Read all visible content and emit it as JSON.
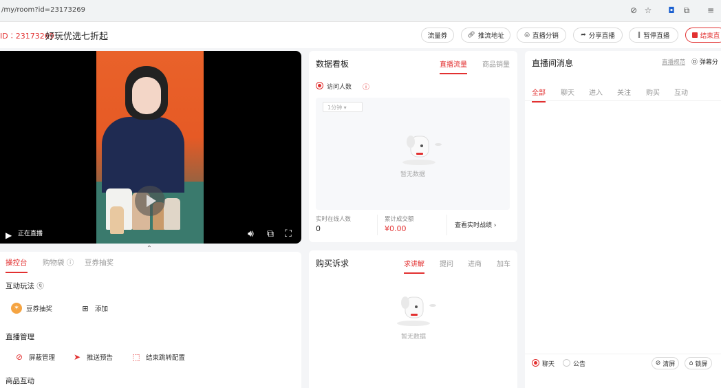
{
  "browser": {
    "url": "/my/room?id=23173269"
  },
  "header": {
    "room_id": "ID︰23173269",
    "title": "好玩优选七折起",
    "buttons": {
      "traffic": "流量券",
      "stream_url": "推流地址",
      "distribution": "直播分销",
      "share": "分享直播",
      "pause": "暂停直播",
      "end": "结束直"
    }
  },
  "video": {
    "status": "正在直播"
  },
  "console": {
    "tabs": [
      "操控台",
      "购物袋",
      "豆券抽奖"
    ],
    "interactive_title": "互动玩法",
    "lottery": "豆券抽奖",
    "add": "添加",
    "live_mgmt_title": "直播管理",
    "tools": [
      "屏蔽管理",
      "推送预告",
      "结束跳转配置"
    ],
    "product_interact_title": "商品互动"
  },
  "dashboard": {
    "title": "数据看板",
    "tabs": [
      "直播流量",
      "商品销量"
    ],
    "metric_radio": "访问人数",
    "interval": "1分钟",
    "empty": "暂无数据",
    "online_label": "实时在线人数",
    "online_value": "0",
    "gmv_label": "累计成交额",
    "gmv_value": "¥0.00",
    "view_realtime": "查看实时战绩"
  },
  "purchase": {
    "title": "购买诉求",
    "tabs": [
      "求讲解",
      "提问",
      "进商",
      "加车"
    ],
    "empty": "暂无数据"
  },
  "messages": {
    "title": "直播间消息",
    "settings": "直播规范",
    "danmaku": "弹幕分",
    "tabs": [
      "全部",
      "聊天",
      "进入",
      "关注",
      "购买",
      "互动"
    ],
    "radio_chat": "聊天",
    "radio_notice": "公告",
    "clear": "清屏",
    "lock": "锁屏"
  },
  "colors": {
    "accent": "#e23030"
  }
}
